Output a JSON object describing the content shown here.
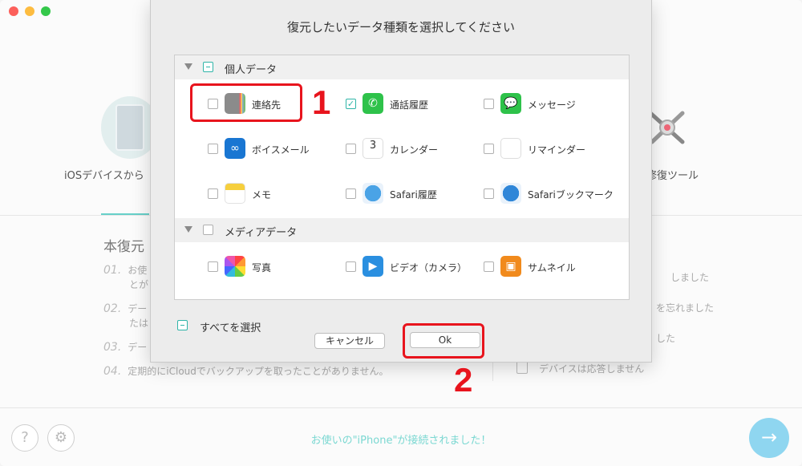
{
  "background": {
    "feature_left_label": "iOSデバイスから",
    "feature_right_label": "修復ツール",
    "heading": "本復元",
    "items": [
      {
        "num": "01.",
        "text": "お使",
        "text2": "とが"
      },
      {
        "num": "02.",
        "text": "デー",
        "text2": "たは"
      },
      {
        "num": "03.",
        "text": "デー"
      },
      {
        "num": "04.",
        "text": "定期的にiCloudでバックアップを取ったことがありません。"
      }
    ],
    "right_lines": [
      "しました",
      "を忘れました",
      "した",
      "デバイスは応答しません"
    ],
    "help_icon": "?",
    "settings_icon": "⚙",
    "status_message": "お使いの\"iPhone\"が接続されました！",
    "next_icon": "→"
  },
  "modal": {
    "title": "復元したいデータ種類を選択してください",
    "groups": [
      {
        "title": "個人データ",
        "state": "mixed",
        "items": [
          {
            "label": "連絡先",
            "icon": "contacts-icon",
            "checked": false
          },
          {
            "label": "通話履歴",
            "icon": "phone-icon",
            "checked": true
          },
          {
            "label": "メッセージ",
            "icon": "messages-icon",
            "checked": false
          },
          {
            "label": "ボイスメール",
            "icon": "voicemail-icon",
            "checked": false
          },
          {
            "label": "カレンダー",
            "icon": "calendar-icon",
            "checked": false,
            "glyph": "3"
          },
          {
            "label": "リマインダー",
            "icon": "reminders-icon",
            "checked": false
          },
          {
            "label": "メモ",
            "icon": "notes-icon",
            "checked": false
          },
          {
            "label": "Safari履歴",
            "icon": "safari-icon",
            "checked": false
          },
          {
            "label": "Safariブックマーク",
            "icon": "safari-bookmark-icon",
            "checked": false
          }
        ]
      },
      {
        "title": "メディアデータ",
        "state": "unchecked",
        "items": [
          {
            "label": "写真",
            "icon": "photos-icon",
            "checked": false
          },
          {
            "label": "ビデオ（カメラ）",
            "icon": "video-icon",
            "checked": false
          },
          {
            "label": "サムネイル",
            "icon": "thumbnail-icon",
            "checked": false
          }
        ]
      }
    ],
    "select_all_label": "すべてを選択",
    "cancel_label": "キャンセル",
    "ok_label": "Ok"
  },
  "annotations": {
    "step1": "1",
    "step2": "2",
    "highlight_color": "#e8141d"
  },
  "colors": {
    "accent": "#2fb5a8",
    "status_text": "#7bd8d2",
    "next_button": "#8fd6f0"
  }
}
